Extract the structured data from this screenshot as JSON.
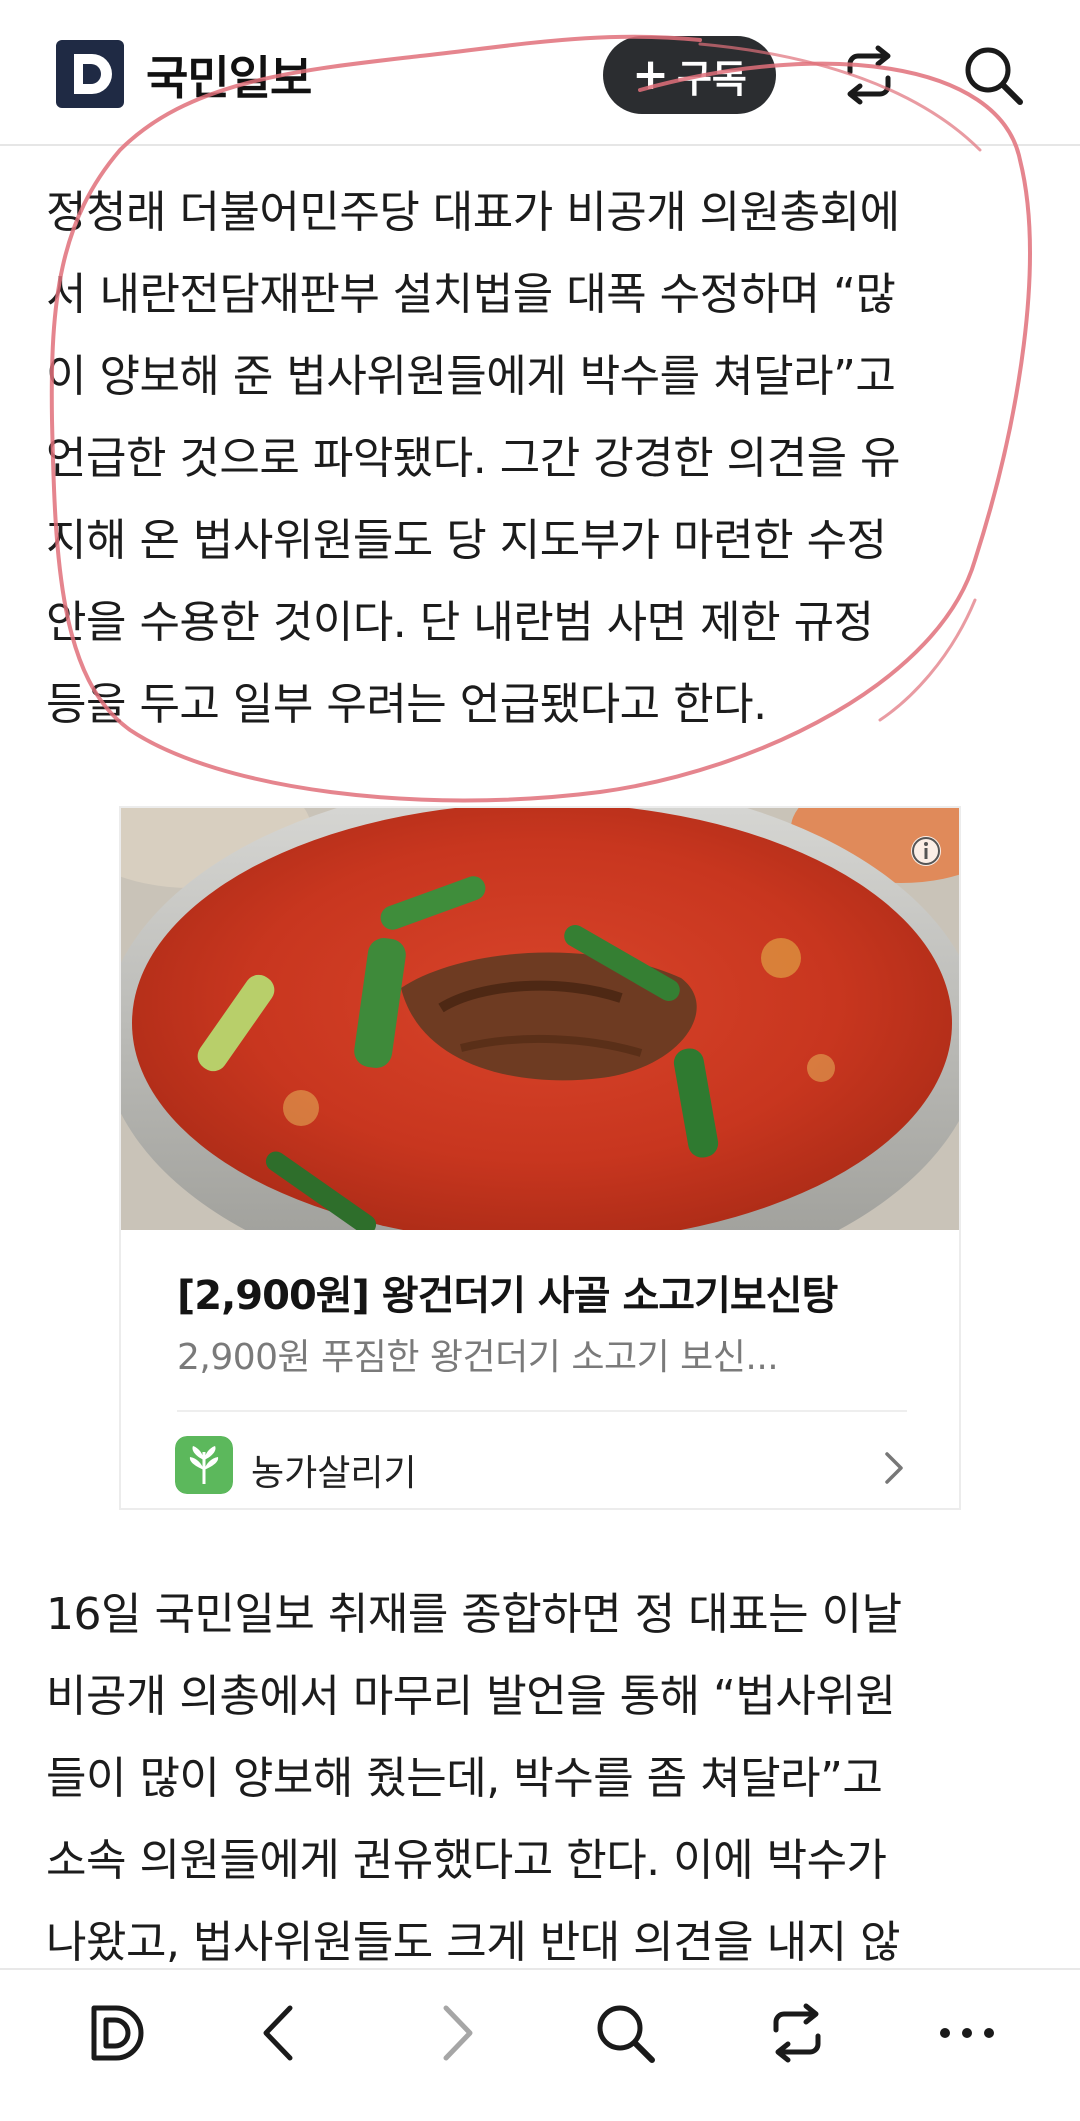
{
  "header": {
    "brand_name": "국민일보",
    "logo_letter": "D",
    "subscribe_plus": "+",
    "subscribe_label": "구독",
    "icons": [
      "logo-d-icon",
      "share-icon",
      "search-icon"
    ]
  },
  "article": {
    "paragraph1": [
      "정청래 더불어민주당 대표가 비공개 의원총회에",
      "서 내란전담재판부 설치법을 대폭 수정하며 “많",
      "이 양보해 준 법사위원들에게 박수를 쳐달라”고",
      "언급한 것으로 파악됐다. 그간 강경한 의견을 유",
      "지해 온 법사위원들도 당 지도부가 마련한 수정",
      "안을 수용한 것이다. 단 내란범 사면 제한 규정",
      "등을 두고 일부 우려는 언급됐다고 한다."
    ],
    "paragraph2": [
      "16일 국민일보 취재를 종합하면 정 대표는 이날",
      "비공개 의총에서 마무리 발언을 통해 “법사위원",
      "들이 많이 양보해 줬는데, 박수를 좀 쳐달라”고",
      "소속 의원들에게 권유했다고 한다. 이에 박수가",
      "나왔고, 법사위원들도 크게 반대 의견을 내지 않"
    ]
  },
  "ad": {
    "title": "[2,900원] 왕건더기 사골 소고기보신탕",
    "description": "2,900원 푸짐한 왕건더기 소고기 보신...",
    "source_name": "농가살리기",
    "info_icon": "info-icon",
    "chevron_icon": "chevron-right-icon"
  },
  "bottom_nav": {
    "items": [
      "logo-d-icon",
      "back-icon",
      "forward-icon",
      "search-icon",
      "share-icon",
      "more-icon"
    ]
  },
  "colors": {
    "subscribe_bg": "#2b2d30",
    "logo_navy": "#1f2a44",
    "annotation_stroke": "#e0707a",
    "source_logo_green": "#5cb85c"
  }
}
